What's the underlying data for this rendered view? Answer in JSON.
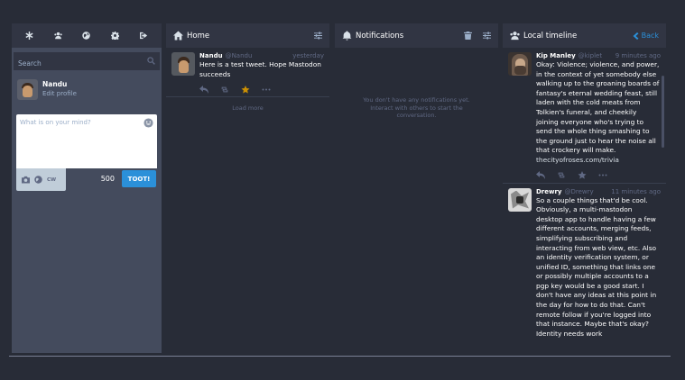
{
  "compose": {
    "nav_icons": [
      "asterisk-icon",
      "users-icon",
      "globe-icon",
      "gear-icon",
      "sign-out-icon"
    ],
    "search_placeholder": "Search",
    "me": {
      "display_name": "Nandu",
      "edit_label": "Edit profile"
    },
    "textarea_placeholder": "What is on your mind?",
    "cw_label": "CW",
    "char_count": "500",
    "toot_label": "TOOT!"
  },
  "home": {
    "title": "Home",
    "status": {
      "display_name": "Nandu",
      "acct": "@Nandu",
      "time": "yesterday",
      "text": "Here is a test tweet. Hope Mastodon succeeds"
    },
    "load_more": "Load more"
  },
  "notifications": {
    "title": "Notifications",
    "empty_text": "You don't have any notifications yet. Interact with others to start the conversation."
  },
  "local": {
    "title": "Local timeline",
    "back_label": "Back",
    "statuses": [
      {
        "display_name": "Kip Manley",
        "acct": "@kiplet",
        "time": "9 minutes ago",
        "text": "Okay: Violence; violence, and power, in the context of yet somebody else walking up to the groaning boards of fantasy's eternal wedding feast, still laden with the cold meats from Tolkien's funeral, and cheekily joining everyone who's trying to send the whole thing smashing to the ground just to hear the noise all that crockery will make.",
        "link": "thecityofroses.com/trivia"
      },
      {
        "display_name": "Drewry",
        "acct": "@Drewry",
        "time": "11 minutes ago",
        "text": "So a couple things that'd be cool. Obviously, a multi-mastodon desktop app to handle having a few different accounts, merging feeds, simplifying subscribing and interacting from web view, etc. Also an identity verification system, or unified ID, something that links one or possibly multiple accounts to a pgp key would be a good start. I don't have any ideas at this point in the day for how to do that. Can't remote follow if you're logged into that instance. Maybe that's okay? Identity needs work"
      }
    ]
  },
  "colors": {
    "background": "#282c37",
    "panel": "#313543",
    "accent": "#2b90d9",
    "favourite": "#ca8f04"
  }
}
